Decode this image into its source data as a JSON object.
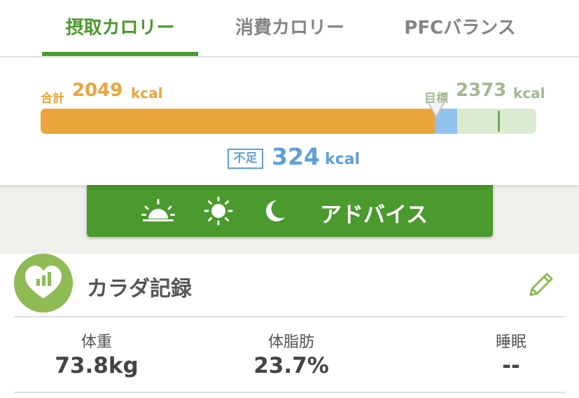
{
  "tabs": [
    {
      "label": "摂取カロリー",
      "active": true
    },
    {
      "label": "消費カロリー",
      "active": false
    },
    {
      "label": "PFCバランス",
      "active": false
    }
  ],
  "intake": {
    "total_label": "合計",
    "total_value": "2049",
    "goal_label": "目標",
    "goal_value": "2373",
    "unit": "kcal",
    "shortage_label": "不足",
    "shortage_value": "324",
    "total_fraction_of_bar": 0.795,
    "goal_fraction_of_bar": 0.84
  },
  "advice": {
    "label": "アドバイス",
    "icons": [
      "sunrise-icon",
      "sun-icon",
      "moon-icon"
    ]
  },
  "body_record": {
    "title": "カラダ記録",
    "icon": "heart-chart-icon",
    "edit_icon": "pencil-icon",
    "metrics": [
      {
        "label": "体重",
        "value": "73.8kg"
      },
      {
        "label": "体脂肪",
        "value": "23.7%"
      },
      {
        "label": "睡眠",
        "value": "--"
      }
    ]
  },
  "colors": {
    "accent_green": "#4a9a2e",
    "intake_orange": "#e9a63b",
    "goal_green": "#a3b98f",
    "shortage_blue": "#5f9fd9",
    "record_icon_green": "#8fbb54"
  }
}
